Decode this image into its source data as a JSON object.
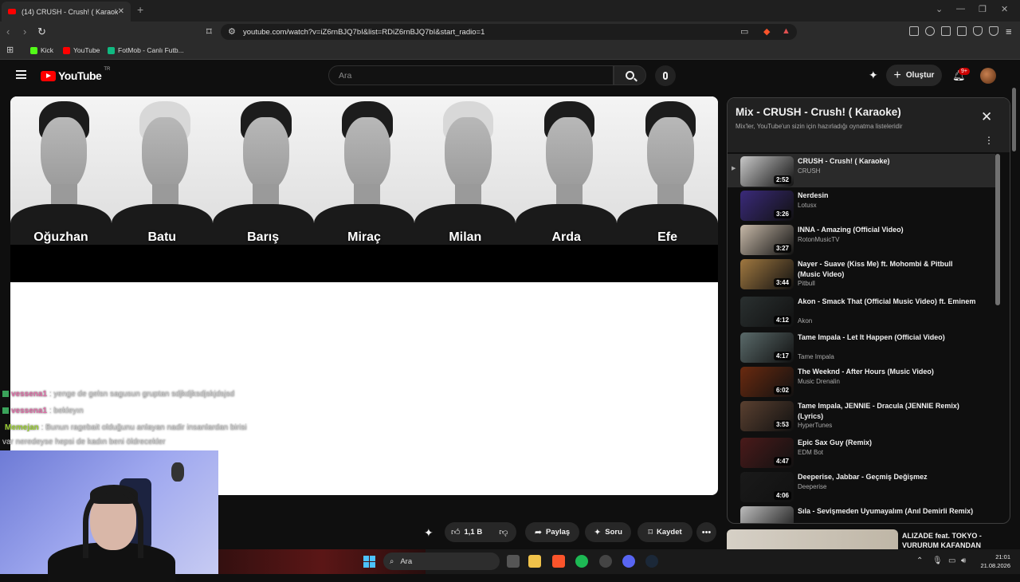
{
  "browser": {
    "tab_title": "(14) CRUSH - Crush! ( Karaoke)",
    "url": "youtube.com/watch?v=iZ6rnBJQ7bI&list=RDiZ6rnBJQ7bI&start_radio=1",
    "bookmarks": [
      {
        "label": "Kick",
        "color": "#53fc18"
      },
      {
        "label": "YouTube",
        "color": "#ff0000"
      },
      {
        "label": "FotMob - Canlı Futb...",
        "color": "#10b981"
      }
    ]
  },
  "youtube": {
    "logo_text": "YouTube",
    "country": "TR",
    "search_placeholder": "Ara",
    "create_label": "Oluştur",
    "notif_count": "9+"
  },
  "video": {
    "members": [
      "Oğuzhan",
      "Batu",
      "Barış",
      "Miraç",
      "Milan",
      "Arda",
      "Efe"
    ]
  },
  "chat": [
    {
      "user": "vessena1",
      "user_color": "#e06fa8",
      "text": ": yenge de gelsn sagusun gruptan sdjkdjksdjskjdsjsd"
    },
    {
      "user": "vessena1",
      "user_color": "#e06fa8",
      "text": ": bekleyın"
    },
    {
      "user": "Memejan",
      "user_color": "#9acd32",
      "text": ": Bunun ragebait olduğunu anlayan nadir insanlardan birisi"
    },
    {
      "user": "",
      "user_color": "#c8c8c8",
      "text": "var neredeyse hepsi de kadın beni öldrecekler"
    }
  ],
  "actions": {
    "likes": "1,1 B",
    "share": "Paylaş",
    "ask": "Soru",
    "save": "Kaydet"
  },
  "playlist": {
    "title": "Mix - CRUSH - Crush! ( Karaoke)",
    "subtitle": "Mix'ler, YouTube'un sizin için hazırladığı oynatma listeleridir",
    "items": [
      {
        "title": "CRUSH - Crush! ( Karaoke)",
        "channel": "CRUSH",
        "duration": "2:52",
        "color": "#c9c9c9"
      },
      {
        "title": "Nerdesin",
        "channel": "Lotusx",
        "duration": "3:26",
        "color": "#3a2a7a"
      },
      {
        "title": "INNA - Amazing (Official Video)",
        "channel": "RotonMusicTV",
        "duration": "3:27",
        "color": "#c7b9a8"
      },
      {
        "title": "Nayer - Suave (Kiss Me) ft. Mohombi & Pitbull (Music Video)",
        "channel": "Pitbull",
        "duration": "3:44",
        "color": "#a07840"
      },
      {
        "title": "Akon - Smack That (Official Music Video) ft. Eminem",
        "channel": "Akon",
        "duration": "4:12",
        "color": "#2a3030"
      },
      {
        "title": "Tame Impala - Let It Happen (Official Video)",
        "channel": "Tame Impala",
        "duration": "4:17",
        "color": "#5a6a6a"
      },
      {
        "title": "The Weeknd - After Hours (Music Video)",
        "channel": "Music Drenalin",
        "duration": "6:02",
        "color": "#6a2a10"
      },
      {
        "title": "Tame Impala, JENNIE - Dracula (JENNIE Remix) (Lyrics)",
        "channel": "HyperTunes",
        "duration": "3:53",
        "color": "#5a4030"
      },
      {
        "title": "Epic Sax Guy (Remix)",
        "channel": "EDM Bot",
        "duration": "4:47",
        "color": "#4a1a1a"
      },
      {
        "title": "Deeperise, Jabbar - Geçmiş Değişmez",
        "channel": "Deeperise",
        "duration": "4:06",
        "color": "#1a1a1a"
      },
      {
        "title": "Sıla - Sevişmeden Uyumayalım (Anıl Demirli Remix)",
        "channel": "",
        "duration": "",
        "color": "#bdbdbd"
      }
    ]
  },
  "suggestion": {
    "title_line1": "ALIZADE feat. TOKYO -",
    "title_line2": "VURURUM KAFANDAN"
  },
  "taskbar": {
    "search_label": "Ara",
    "time": "21:01",
    "date": "21.08.2026"
  }
}
